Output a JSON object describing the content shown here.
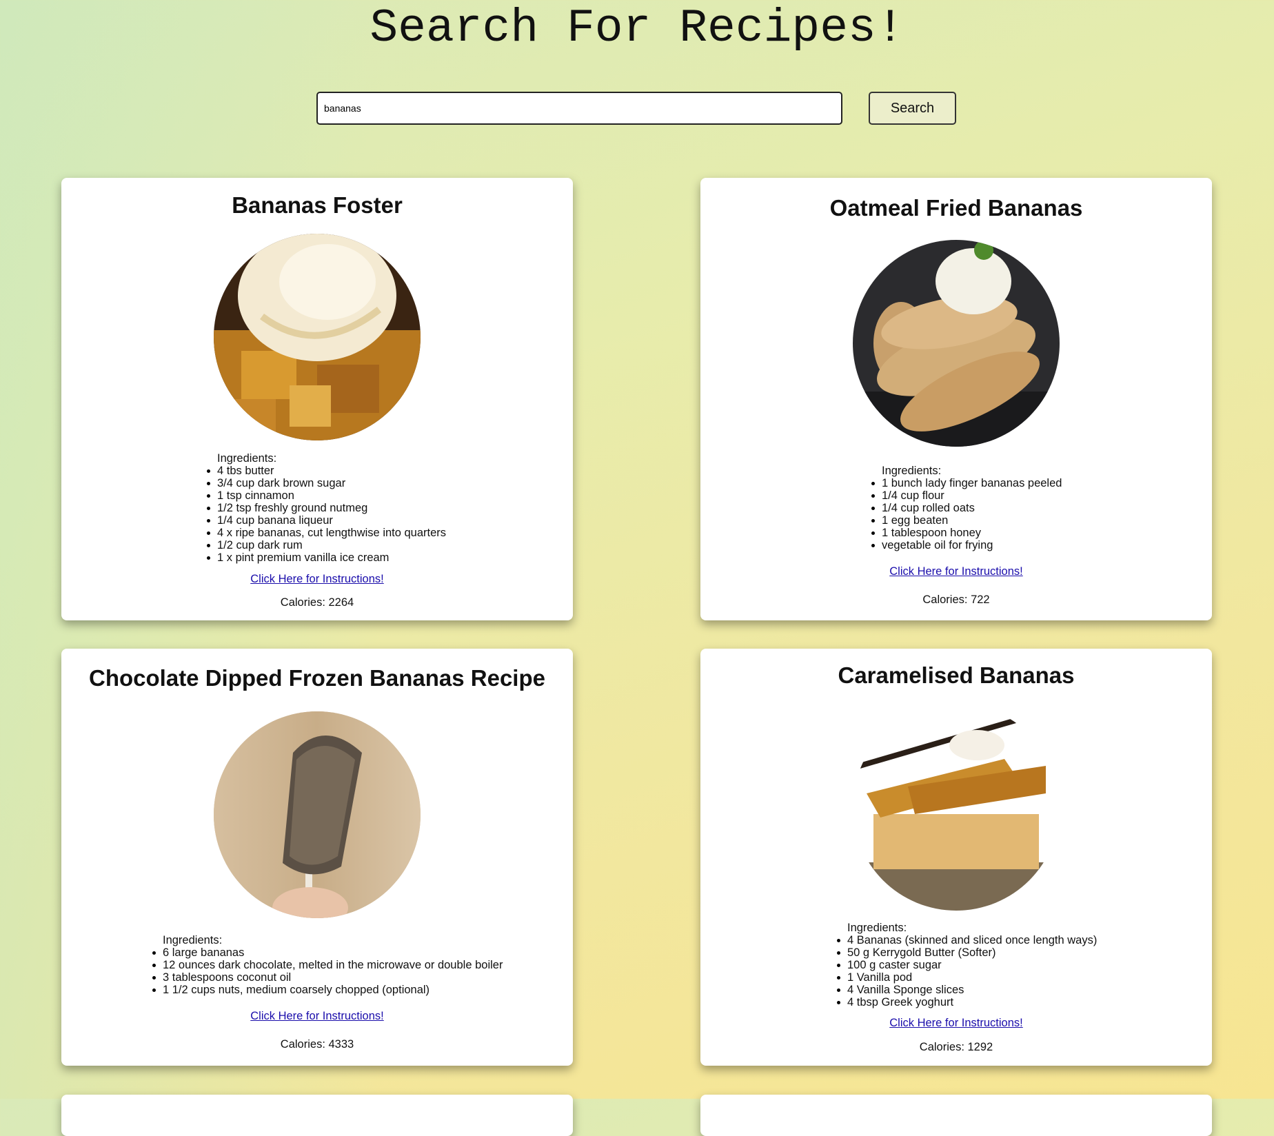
{
  "page": {
    "title": "Search For Recipes!"
  },
  "search": {
    "value": "bananas",
    "button_label": "Search"
  },
  "recipes": [
    {
      "title": "Bananas Foster",
      "ingredients_label": "Ingredients:",
      "ingredients": [
        "4 tbs butter",
        "3/4 cup dark brown sugar",
        "1 tsp cinnamon",
        "1/2 tsp freshly ground nutmeg",
        "1/4 cup banana liqueur",
        "4 x ripe bananas, cut lengthwise into quarters",
        "1/2 cup dark rum",
        "1 x pint premium vanilla ice cream"
      ],
      "link_text": "Click Here for Instructions!",
      "calories": "Calories: 2264"
    },
    {
      "title": "Oatmeal Fried Bananas",
      "ingredients_label": "Ingredients:",
      "ingredients": [
        "1 bunch lady finger bananas peeled",
        "1/4 cup flour",
        "1/4 cup rolled oats",
        "1 egg beaten",
        "1 tablespoon honey",
        "vegetable oil for frying"
      ],
      "link_text": "Click Here for Instructions!",
      "calories": "Calories: 722"
    },
    {
      "title": "Chocolate Dipped Frozen Bananas Recipe",
      "ingredients_label": "Ingredients:",
      "ingredients": [
        "6 large bananas",
        "12 ounces dark chocolate, melted in the microwave or double boiler",
        "3 tablespoons coconut oil",
        "1 1/2 cups nuts, medium coarsely chopped (optional)"
      ],
      "link_text": "Click Here for Instructions!",
      "calories": "Calories: 4333"
    },
    {
      "title": "Caramelised Bananas",
      "ingredients_label": "Ingredients:",
      "ingredients": [
        "4 Bananas (skinned and sliced once length ways)",
        "50 g Kerrygold Butter (Softer)",
        "100 g caster sugar",
        "1 Vanilla pod",
        "4 Vanilla Sponge slices",
        "4 tbsp Greek yoghurt"
      ],
      "link_text": "Click Here for Instructions!",
      "calories": "Calories: 1292"
    }
  ],
  "colors": {
    "link": "#1a0dab",
    "button_bg": "#eceecb"
  }
}
